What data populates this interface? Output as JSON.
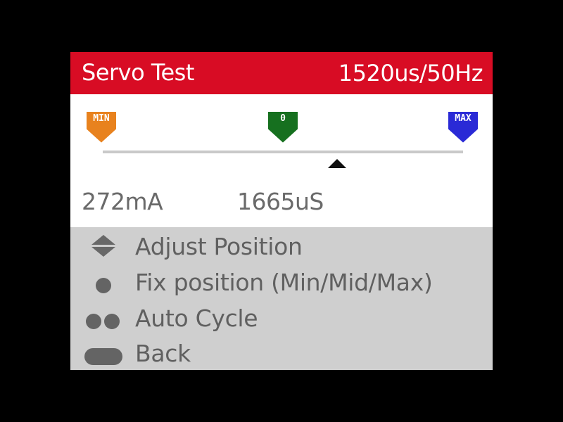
{
  "header": {
    "title": "Servo Test",
    "pulse_rate": "1520us/50Hz"
  },
  "colors": {
    "header_bg": "#d80c24",
    "min_marker": "#e8821e",
    "zero_marker": "#16701f",
    "max_marker": "#2a2ad6",
    "help_bg": "#cfcfcf"
  },
  "markers": {
    "min_label": "MIN",
    "zero_label": "0",
    "max_label": "MAX"
  },
  "position_indicator": {
    "fraction": 0.65
  },
  "readouts": {
    "current": "272mA",
    "pulse_width": "1665uS"
  },
  "help": {
    "items": [
      {
        "icon": "up-down-arrows-icon",
        "label": "Adjust Position"
      },
      {
        "icon": "single-dot-icon",
        "label": "Fix position (Min/Mid/Max)"
      },
      {
        "icon": "double-dot-icon",
        "label": "Auto Cycle"
      },
      {
        "icon": "long-press-icon",
        "label": "Back"
      }
    ]
  }
}
